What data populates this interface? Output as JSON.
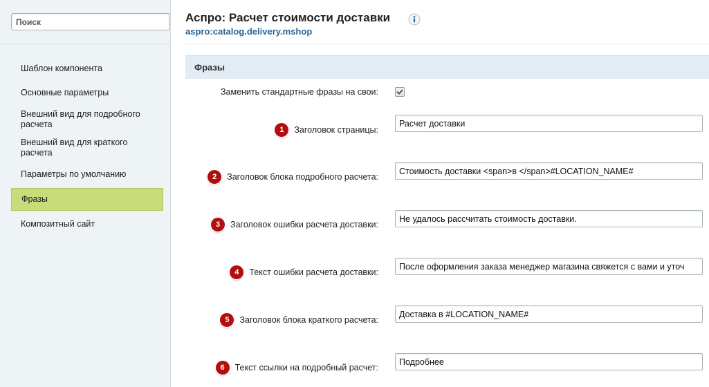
{
  "sidebar": {
    "search_placeholder": "Поиск",
    "items": [
      {
        "label": "Шаблон компонента"
      },
      {
        "label": "Основные параметры"
      },
      {
        "label": "Внешний вид для подробного расчета"
      },
      {
        "label": "Внешний вид для краткого расчета"
      },
      {
        "label": "Параметры по умолчанию"
      },
      {
        "label": "Фразы"
      },
      {
        "label": "Композитный сайт"
      }
    ],
    "active_item": "Фразы"
  },
  "header": {
    "title": "Аспро: Расчет стоимости доставки",
    "subtitle": "aspro:catalog.delivery.mshop",
    "info_icon": "info-icon"
  },
  "section": {
    "title": "Фразы"
  },
  "form": {
    "replace_phrases": {
      "label": "Заменить стандартные фразы на свои:",
      "checked": true
    },
    "fields": [
      {
        "number": "1",
        "label": "Заголовок страницы:",
        "value": "Расчет доставки"
      },
      {
        "number": "2",
        "label": "Заголовок блока подробного расчета:",
        "value": "Стоимость доставки <span>в </span>#LOCATION_NAME#"
      },
      {
        "number": "3",
        "label": "Заголовок ошибки расчета доставки:",
        "value": "Не удалось рассчитать стоимость доставки."
      },
      {
        "number": "4",
        "label": "Текст ошибки расчета доставки:",
        "value": "После оформления заказа менеджер магазина свяжется с вами и уточ"
      },
      {
        "number": "5",
        "label": "Заголовок блока краткого расчета:",
        "value": "Доставка в #LOCATION_NAME#"
      },
      {
        "number": "6",
        "label": "Текст ссылки на подробный расчет:",
        "value": "Подробнее"
      }
    ]
  },
  "colors": {
    "badge": "#b20e10",
    "active_nav": "#c9dc7c",
    "section_bar": "#e2ecf4",
    "link": "#2a6496"
  }
}
